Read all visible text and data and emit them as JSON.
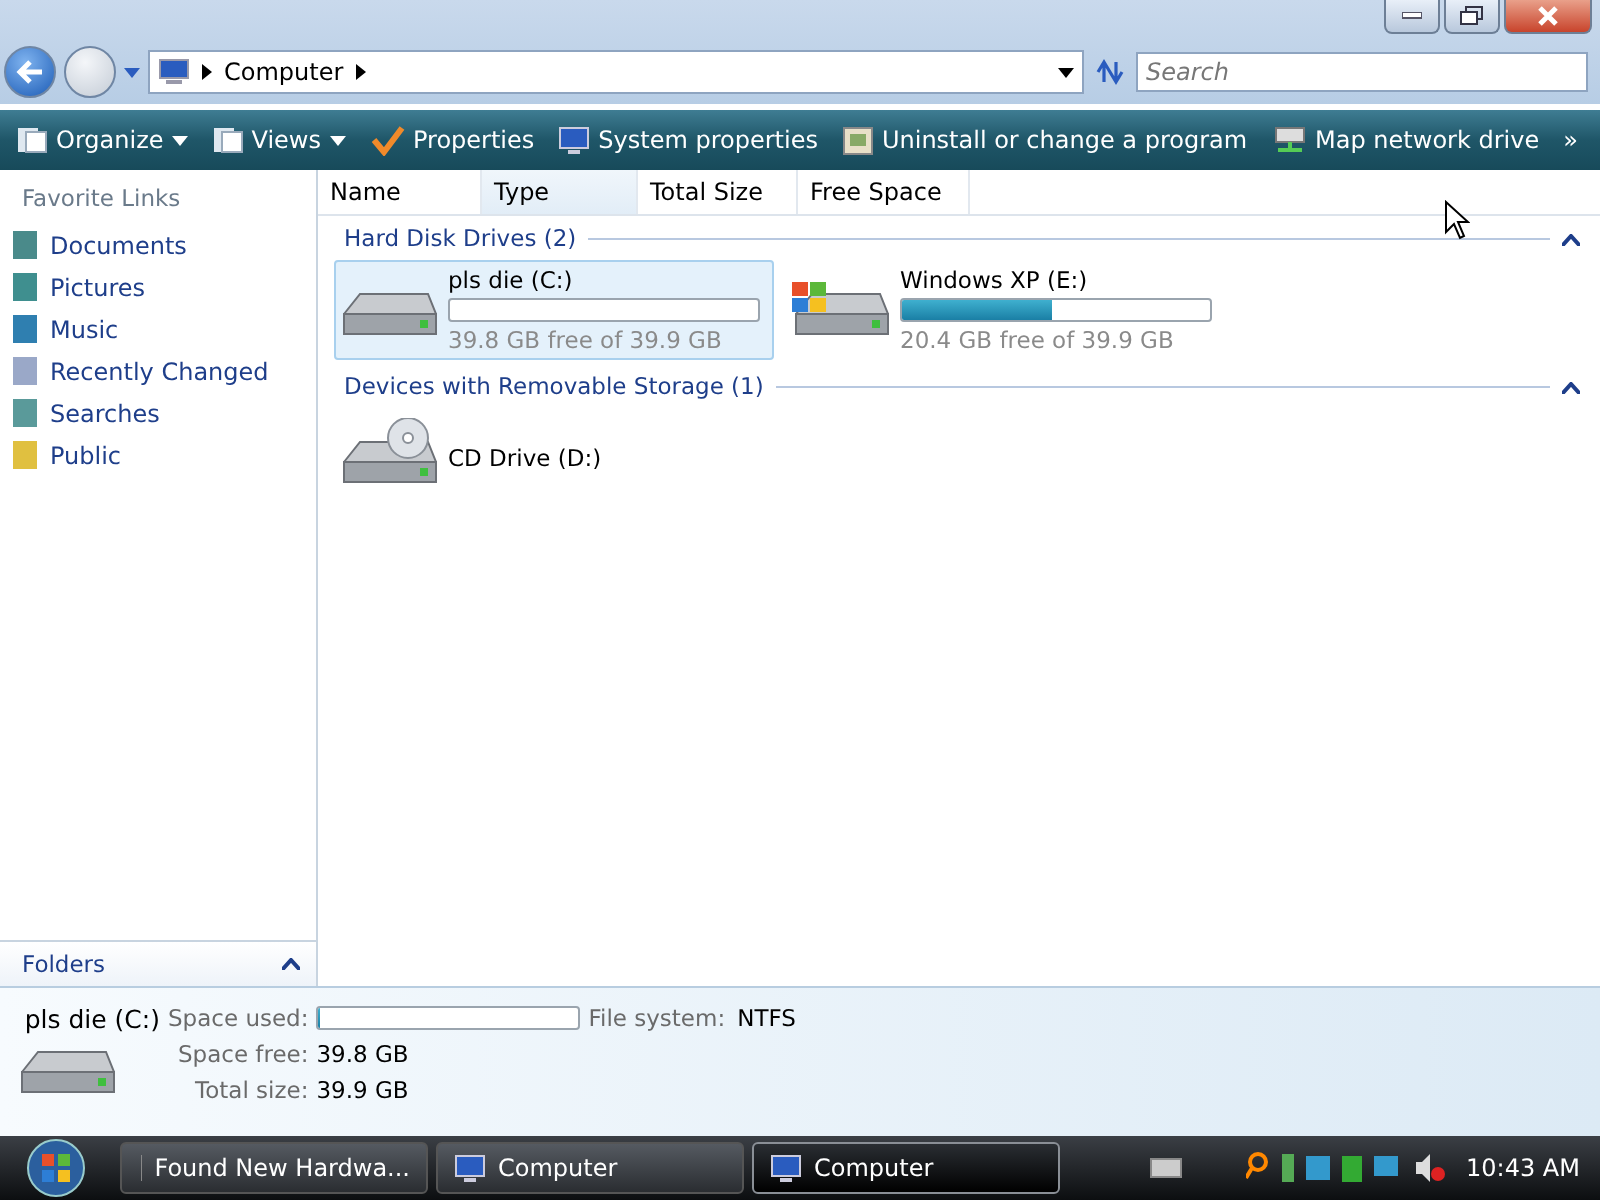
{
  "address": {
    "path": [
      "Computer"
    ],
    "search": {
      "placeholder": "Search"
    }
  },
  "toolbar": [
    {
      "label": "Organize",
      "kind": "menu"
    },
    {
      "label": "Views",
      "kind": "menu"
    },
    {
      "label": "Properties",
      "kind": "check"
    },
    {
      "label": "System properties",
      "kind": "monitor"
    },
    {
      "label": "Uninstall or change a program",
      "kind": "box"
    },
    {
      "label": "Map network drive",
      "kind": "network"
    },
    {
      "label": "»",
      "kind": "more"
    }
  ],
  "columns": [
    {
      "label": "Name",
      "selected": false
    },
    {
      "label": "Type",
      "selected": true
    },
    {
      "label": "Total Size",
      "selected": false
    },
    {
      "label": "Free Space",
      "selected": false
    }
  ],
  "sidebar": {
    "title": "Favorite Links",
    "items": [
      {
        "label": "Documents",
        "color": "#4a8a8a"
      },
      {
        "label": "Pictures",
        "color": "#3f8f8f"
      },
      {
        "label": "Music",
        "color": "#2f7fb0"
      },
      {
        "label": "Recently Changed",
        "color": "#9aa8c8"
      },
      {
        "label": "Searches",
        "color": "#5a9a9a"
      },
      {
        "label": "Public",
        "color": "#e0c040"
      }
    ],
    "folders": "Folders"
  },
  "groups": [
    {
      "title": "Hard Disk Drives (2)",
      "expanded": true,
      "items": [
        {
          "name": "pls die (C:)",
          "kind": "disk",
          "level": 0.003,
          "free": "39.8 GB free of 39.9 GB",
          "selected": true
        },
        {
          "name": "Windows XP (E:)",
          "kind": "windows",
          "level": 0.49,
          "free": "20.4 GB free of 39.9 GB",
          "selected": false
        }
      ]
    },
    {
      "title": "Devices with Removable Storage (1)",
      "expanded": true,
      "items": [
        {
          "name": "CD Drive (D:)",
          "kind": "cd",
          "selected": false
        }
      ]
    }
  ],
  "details": {
    "name": "pls die (C:)",
    "used": {
      "label": "Space used:",
      "level": 0.003
    },
    "fs_label": "File system:",
    "fs": "NTFS",
    "free_label": "Space free:",
    "free": "39.8 GB",
    "total_label": "Total size:",
    "total": "39.9 GB"
  },
  "taskbar": {
    "tasks": [
      {
        "label": "Found New Hardwa...",
        "kind": "hardware",
        "selected": false
      },
      {
        "label": "Computer",
        "kind": "computer",
        "selected": false
      },
      {
        "label": "Computer",
        "kind": "computer",
        "selected": true
      }
    ],
    "clock": "10:43 AM"
  }
}
